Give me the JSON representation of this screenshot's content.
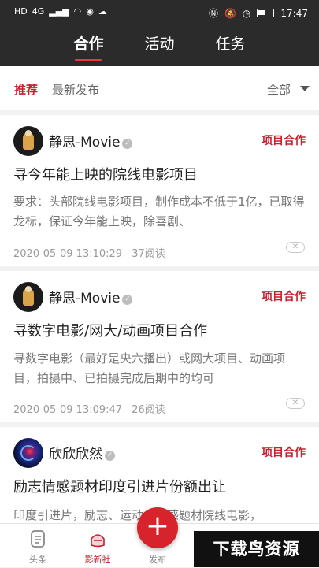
{
  "status_bar": {
    "left_icons": [
      "HD",
      "4G"
    ],
    "time": "17:47"
  },
  "top_tabs": [
    {
      "label": "合作",
      "active": true
    },
    {
      "label": "活动",
      "active": false
    },
    {
      "label": "任务",
      "active": false
    }
  ],
  "filter": {
    "recommended": "推荐",
    "latest": "最新发布",
    "all": "全部"
  },
  "cards": [
    {
      "user": "静思-Movie",
      "tag": "项目合作",
      "title": "寻今年能上映的院线电影项目",
      "desc": "要求：头部院线电影项目，制作成本不低于1亿，已取得龙标，保证今年能上映，除喜剧、",
      "date": "2020-05-09 13:10:29",
      "reads": "37阅读"
    },
    {
      "user": "静思-Movie",
      "tag": "项目合作",
      "title": "寻数字电影/网大/动画项目合作",
      "desc": "寻数字电影（最好是央六播出）或网大项目、动画项目，拍摄中、已拍摄完成后期中的均可",
      "date": "2020-05-09 13:09:47",
      "reads": "26阅读"
    },
    {
      "user": "欣欣欣然",
      "tag": "项目合作",
      "title": "励志情感题材印度引进片份额出让",
      "desc": "印度引进片，励志、运动、情感题材院线电影，"
    }
  ],
  "bottom_nav": {
    "toutiao": "头条",
    "yingxinshe": "影新社",
    "publish": "发布"
  },
  "watermark": "下载鸟资源",
  "colors": {
    "accent": "#c8202d",
    "header_bg": "#2b2b2b",
    "fab": "#d7232b"
  }
}
